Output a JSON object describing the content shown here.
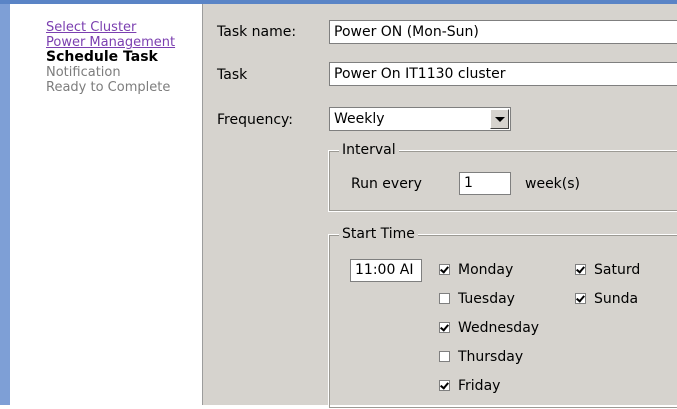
{
  "steps": [
    {
      "label": "Select Cluster",
      "state": "link"
    },
    {
      "label": "Power Management",
      "state": "link"
    },
    {
      "label": "Schedule Task",
      "state": "current"
    },
    {
      "label": "Notification",
      "state": "pending"
    },
    {
      "label": "Ready to Complete",
      "state": "pending"
    }
  ],
  "form": {
    "task_name_label": "Task name:",
    "task_name_value": "Power ON (Mon-Sun)",
    "task_label": "Task",
    "task_value": "Power On IT1130 cluster",
    "frequency_label": "Frequency:",
    "frequency_value": "Weekly"
  },
  "interval": {
    "title": "Interval",
    "run_every_label": "Run every",
    "value": "1",
    "unit": "week(s)"
  },
  "start_time": {
    "title": "Start Time",
    "time_value": "11:00 AI",
    "days": [
      {
        "label": "Monday",
        "checked": true
      },
      {
        "label": "Tuesday",
        "checked": false
      },
      {
        "label": "Wednesday",
        "checked": true
      },
      {
        "label": "Thursday",
        "checked": false
      },
      {
        "label": "Friday",
        "checked": true
      },
      {
        "label": "Saturd",
        "checked": true
      },
      {
        "label": "Sunda",
        "checked": true
      }
    ]
  }
}
